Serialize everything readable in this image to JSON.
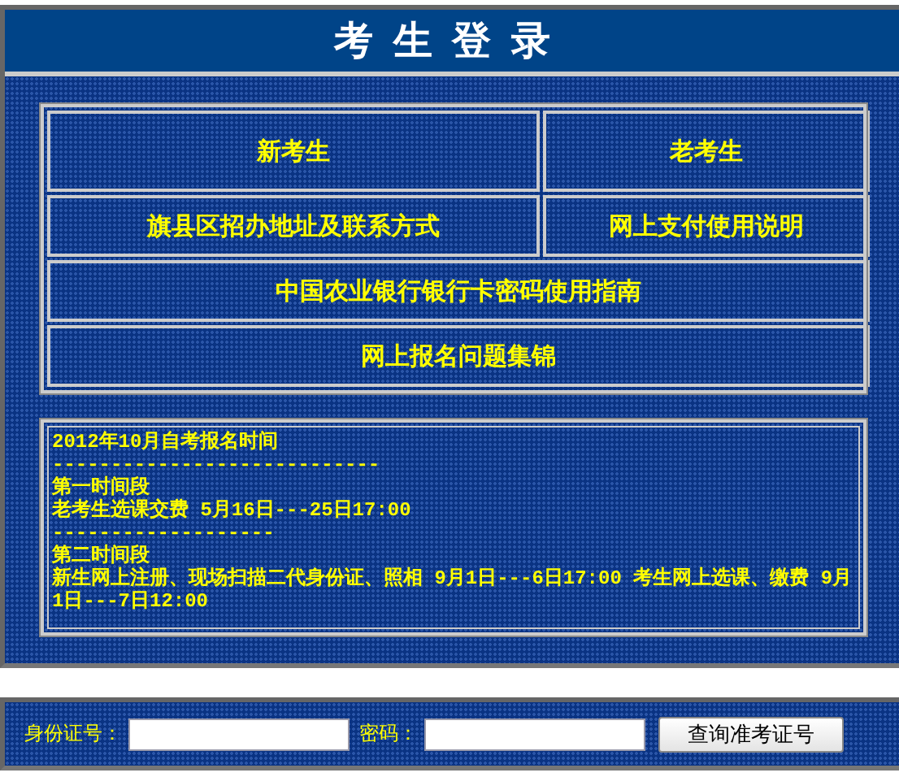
{
  "header": {
    "title": "考 生 登 录"
  },
  "links": [
    {
      "label": "新考生",
      "span": false
    },
    {
      "label": "老考生",
      "span": false
    },
    {
      "label": "旗县区招办地址及联系方式",
      "span": false
    },
    {
      "label": "网上支付使用说明",
      "span": false
    },
    {
      "label": "中国农业银行银行卡密码使用指南",
      "span": true
    },
    {
      "label": "网上报名问题集锦",
      "span": true
    }
  ],
  "notice": {
    "lines": [
      "2012年10月自考报名时间",
      "----------------------------",
      "第一时间段",
      "老考生选课交费 5月16日---25日17:00",
      "-------------------",
      "第二时间段",
      "新生网上注册、现场扫描二代身份证、照相 9月1日---6日17:00 考生网上选课、缴费 9月1日---7日12:00"
    ]
  },
  "query": {
    "id_label": "身份证号：",
    "password_label": "密码：",
    "button": "查询准考证号"
  }
}
